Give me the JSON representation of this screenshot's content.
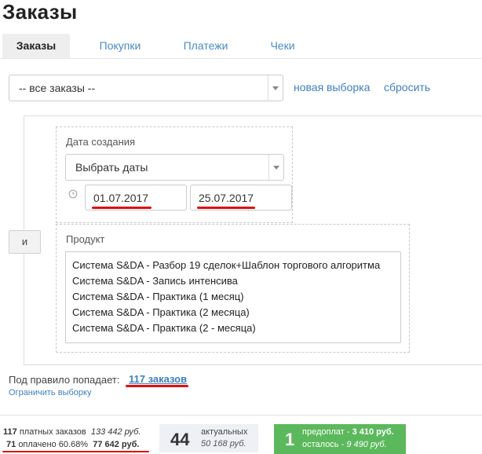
{
  "page": {
    "title": "Заказы"
  },
  "tabs": [
    {
      "label": "Заказы",
      "active": true
    },
    {
      "label": "Покупки",
      "active": false
    },
    {
      "label": "Платежи",
      "active": false
    },
    {
      "label": "Чеки",
      "active": false
    }
  ],
  "filter_bar": {
    "select_value": "-- все заказы --",
    "new_selection_link": "новая выборка",
    "reset_link": "сбросить"
  },
  "rule": {
    "connector_button": "и",
    "date_block": {
      "label": "Дата создания",
      "select_value": "Выбрать даты",
      "date_from": "01.07.2017",
      "date_to": "25.07.2017"
    },
    "product_block": {
      "label": "Продукт",
      "options": [
        "Система S&DA - Разбор 19 сделок+Шаблон торгового алгоритма",
        "Система S&DA - Запись интенсива",
        "Система S&DA - Практика (1 месяц)",
        "Система S&DA - Практика (2 месяца)",
        "Система S&DA - Практика (2 - месяца)"
      ]
    }
  },
  "result": {
    "label": "Под правило попадает:",
    "count_link": "117 заказов",
    "limit_link": "Ограничить выборку"
  },
  "stats": {
    "paid_orders_count": "117",
    "paid_orders_label": "платных заказов",
    "paid_orders_sum": "133 442 руб.",
    "paid_count": "71",
    "paid_label": "оплачено 60.68%",
    "paid_sum": "77 642 руб.",
    "actual_count": "44",
    "actual_label": "актуальных",
    "actual_sum": "50 168 руб.",
    "prepay_count": "1",
    "prepay_label": "предоплат -",
    "prepay_sum": "3 410 руб.",
    "remaining_label": "осталось -",
    "remaining_sum": "9 490 руб."
  },
  "colors": {
    "accent_link": "#3f7fbf",
    "highlight_underline": "#e01010",
    "prepay_box": "#5cb85c",
    "actual_box": "#eef0f5"
  }
}
